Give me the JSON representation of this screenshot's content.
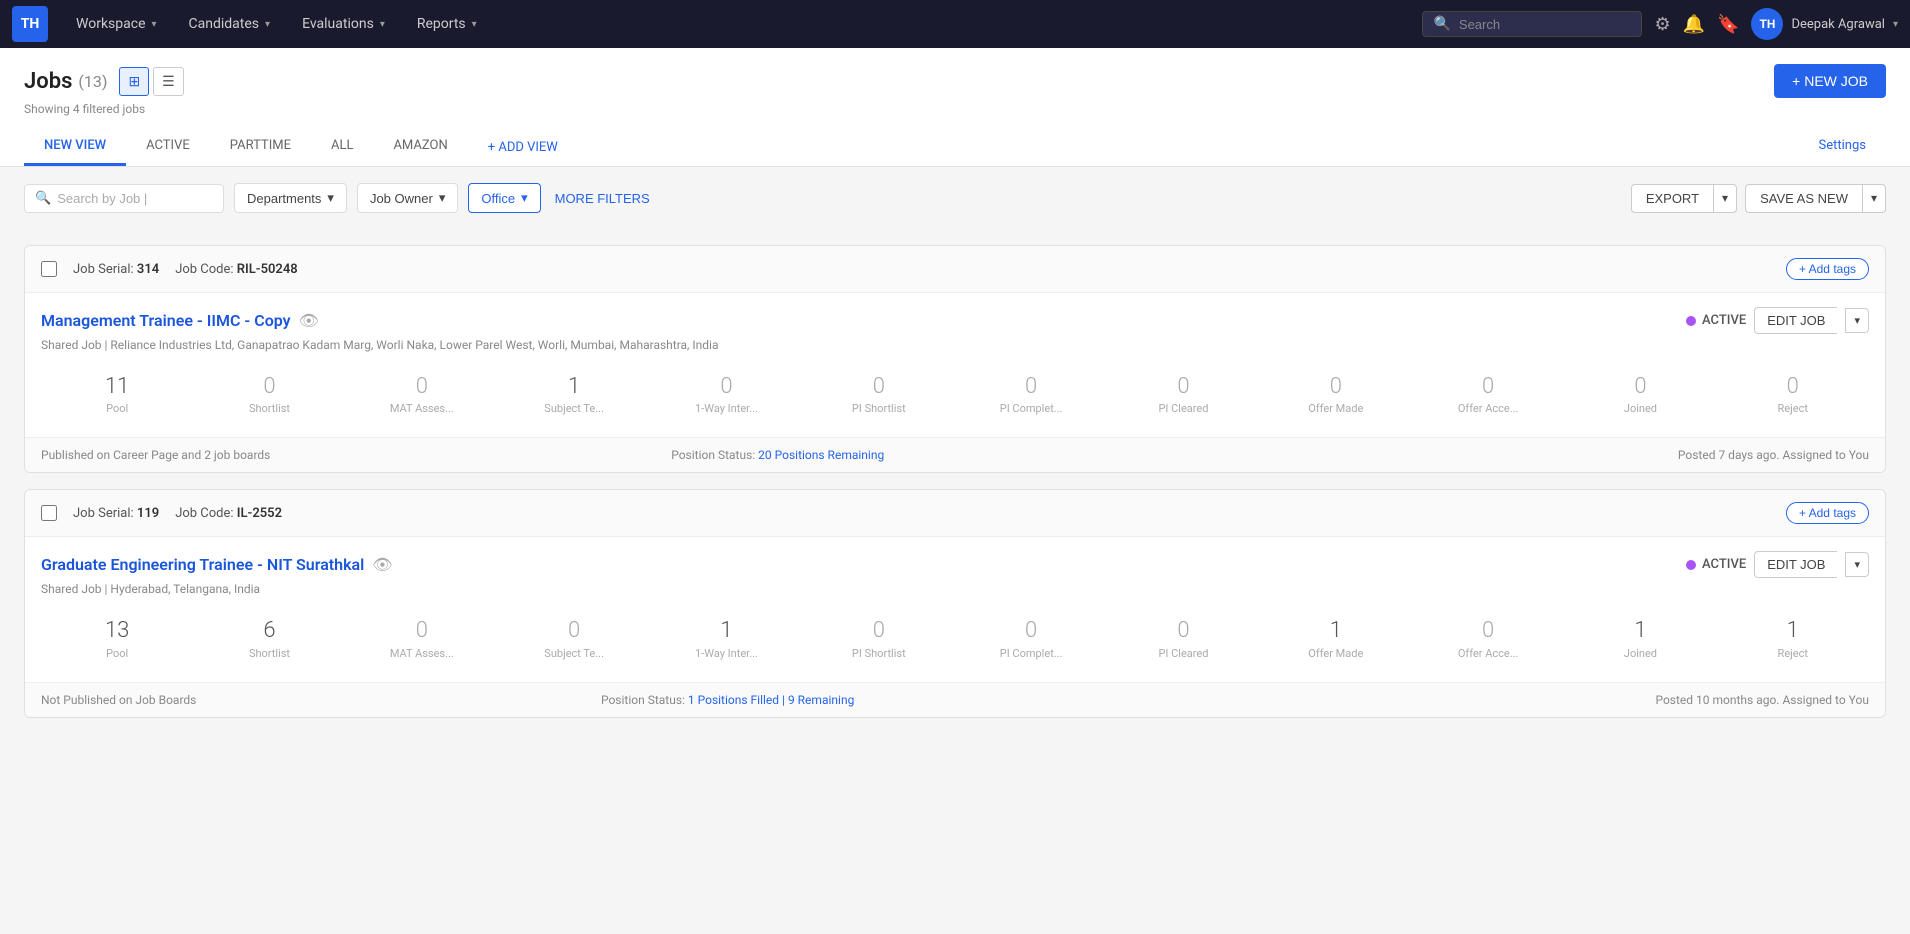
{
  "navbar": {
    "brand": "TH",
    "menu": [
      {
        "label": "Workspace",
        "id": "workspace"
      },
      {
        "label": "Candidates",
        "id": "candidates"
      },
      {
        "label": "Evaluations",
        "id": "evaluations"
      },
      {
        "label": "Reports",
        "id": "reports"
      }
    ],
    "search_placeholder": "Search",
    "user": {
      "initials": "TH",
      "name": "Deepak Agrawal"
    }
  },
  "page": {
    "title": "Jobs",
    "count": "(13)",
    "subtitle": "Showing 4 filtered jobs",
    "new_job_label": "+ NEW JOB"
  },
  "tabs": [
    {
      "label": "NEW VIEW",
      "active": true
    },
    {
      "label": "ACTIVE",
      "active": false
    },
    {
      "label": "PARTTIME",
      "active": false
    },
    {
      "label": "ALL",
      "active": false
    },
    {
      "label": "AMAZON",
      "active": false
    }
  ],
  "tab_add": "+ ADD VIEW",
  "tab_settings": "Settings",
  "filters": {
    "search_placeholder": "Search by Job |",
    "departments_label": "Departments",
    "job_owner_label": "Job Owner",
    "office_label": "Office",
    "more_filters_label": "MORE FILTERS",
    "export_label": "EXPORT",
    "save_as_new_label": "SAVE AS NEW"
  },
  "jobs": [
    {
      "serial": "314",
      "code": "RIL-50248",
      "title": "Management Trainee - IIMC - Copy",
      "status": "ACTIVE",
      "shared": "Shared Job",
      "location": "Reliance Industries Ltd, Ganapatrao Kadam Marg, Worli Naka, Lower Parel West, Worli, Mumbai, Maharashtra, India",
      "stats": [
        {
          "number": "11",
          "label": "Pool",
          "has_value": true
        },
        {
          "number": "0",
          "label": "Shortlist",
          "has_value": false
        },
        {
          "number": "0",
          "label": "MAT Asses...",
          "has_value": false
        },
        {
          "number": "1",
          "label": "Subject Te...",
          "has_value": true
        },
        {
          "number": "0",
          "label": "1-Way Inter...",
          "has_value": false
        },
        {
          "number": "0",
          "label": "PI Shortlist",
          "has_value": false
        },
        {
          "number": "0",
          "label": "PI Complet...",
          "has_value": false
        },
        {
          "number": "0",
          "label": "PI Cleared",
          "has_value": false
        },
        {
          "number": "0",
          "label": "Offer Made",
          "has_value": false
        },
        {
          "number": "0",
          "label": "Offer Acce...",
          "has_value": false
        },
        {
          "number": "0",
          "label": "Joined",
          "has_value": false
        },
        {
          "number": "0",
          "label": "Reject",
          "has_value": false
        }
      ],
      "footer_left": "Published on Career Page and 2 job boards",
      "footer_status_label": "Position Status:",
      "footer_status_value": "20 Positions Remaining",
      "footer_right": "Posted 7 days ago. Assigned to You"
    },
    {
      "serial": "119",
      "code": "IL-2552",
      "title": "Graduate Engineering Trainee - NIT Surathkal",
      "status": "ACTIVE",
      "shared": "Shared Job",
      "location": "Hyderabad, Telangana, India",
      "stats": [
        {
          "number": "13",
          "label": "Pool",
          "has_value": true
        },
        {
          "number": "6",
          "label": "Shortlist",
          "has_value": true
        },
        {
          "number": "0",
          "label": "MAT Asses...",
          "has_value": false
        },
        {
          "number": "0",
          "label": "Subject Te...",
          "has_value": false
        },
        {
          "number": "1",
          "label": "1-Way Inter...",
          "has_value": true
        },
        {
          "number": "0",
          "label": "PI Shortlist",
          "has_value": false
        },
        {
          "number": "0",
          "label": "PI Complet...",
          "has_value": false
        },
        {
          "number": "0",
          "label": "PI Cleared",
          "has_value": false
        },
        {
          "number": "1",
          "label": "Offer Made",
          "has_value": true
        },
        {
          "number": "0",
          "label": "Offer Acce...",
          "has_value": false
        },
        {
          "number": "1",
          "label": "Joined",
          "has_value": true
        },
        {
          "number": "1",
          "label": "Reject",
          "has_value": true
        }
      ],
      "footer_left": "Not Published on Job Boards",
      "footer_status_label": "Position Status:",
      "footer_status_value": "1 Positions Filled | 9 Remaining",
      "footer_right": "Posted 10 months ago. Assigned to You"
    }
  ]
}
